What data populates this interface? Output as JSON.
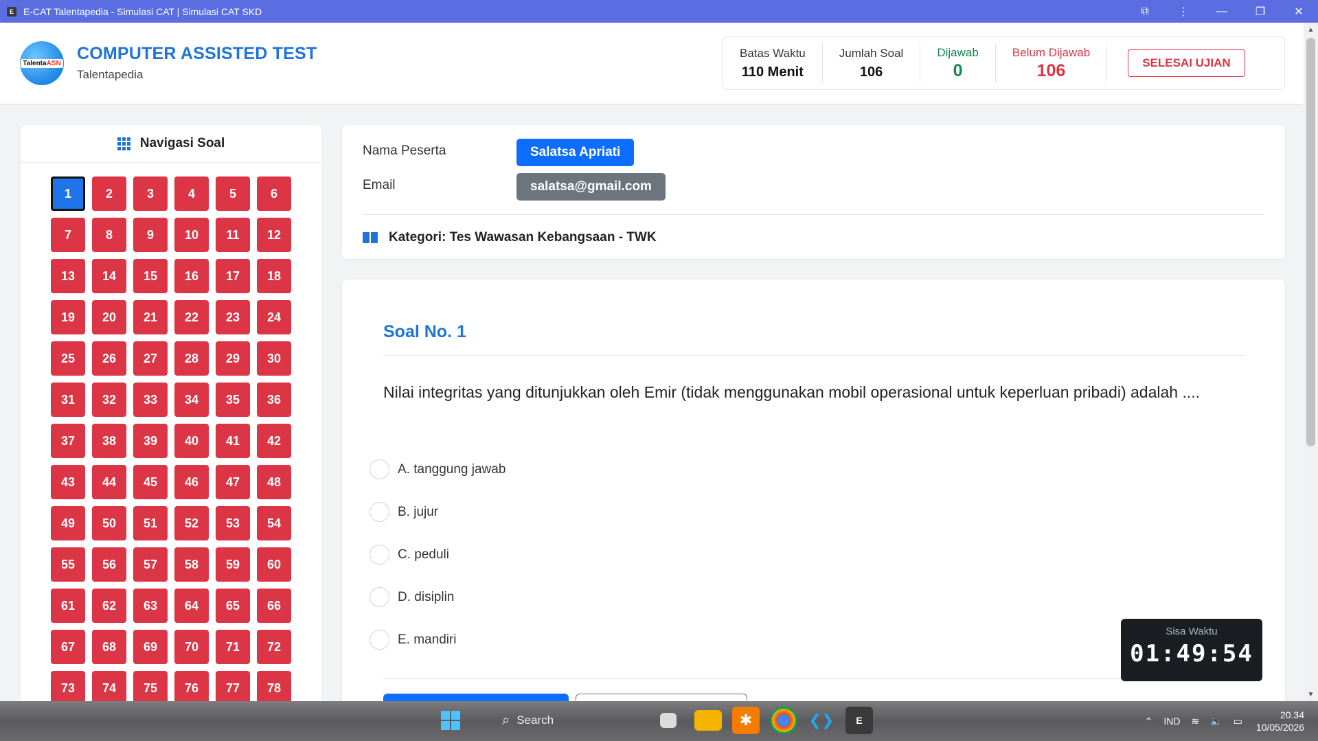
{
  "window": {
    "title": "E-CAT Talentapedia - Simulasi CAT | Simulasi CAT SKD",
    "app_icon_letter": "E"
  },
  "header": {
    "logo_text_a": "Talenta",
    "logo_text_b": "ASN",
    "title": "COMPUTER ASSISTED TEST",
    "subtitle": "Talentapedia",
    "stats": {
      "time_limit_label": "Batas Waktu",
      "time_limit_value": "110 Menit",
      "total_label": "Jumlah Soal",
      "total_value": "106",
      "answered_label": "Dijawab",
      "answered_value": "0",
      "unanswered_label": "Belum Dijawab",
      "unanswered_value": "106"
    },
    "finish_button": "SELESAI UJIAN"
  },
  "navigation": {
    "title": "Navigasi Soal",
    "active": 1,
    "visible_count": 78
  },
  "participant": {
    "name_label": "Nama Peserta",
    "name": "Salatsa Apriati",
    "email_label": "Email",
    "email": "salatsa@gmail.com",
    "category": "Kategori: Tes Wawasan Kebangsaan - TWK"
  },
  "question": {
    "title": "Soal No. 1",
    "text": "Nilai integritas yang ditunjukkan oleh Emir (tidak menggunakan mobil operasional untuk keperluan pribadi) adalah ....",
    "options": [
      "A. tanggung jawab",
      "B. jujur",
      "C. peduli",
      "D. disiplin",
      "E. mandiri"
    ]
  },
  "timer": {
    "label": "Sisa Waktu",
    "value": "01:49:54"
  },
  "taskbar": {
    "search_placeholder": "Search",
    "language": "IND",
    "time": "20.34",
    "date": "10/05/2026"
  },
  "colors": {
    "accent": "#1e74d8",
    "danger": "#dc3545",
    "success": "#198754",
    "titlebar": "#5b6ee1"
  }
}
